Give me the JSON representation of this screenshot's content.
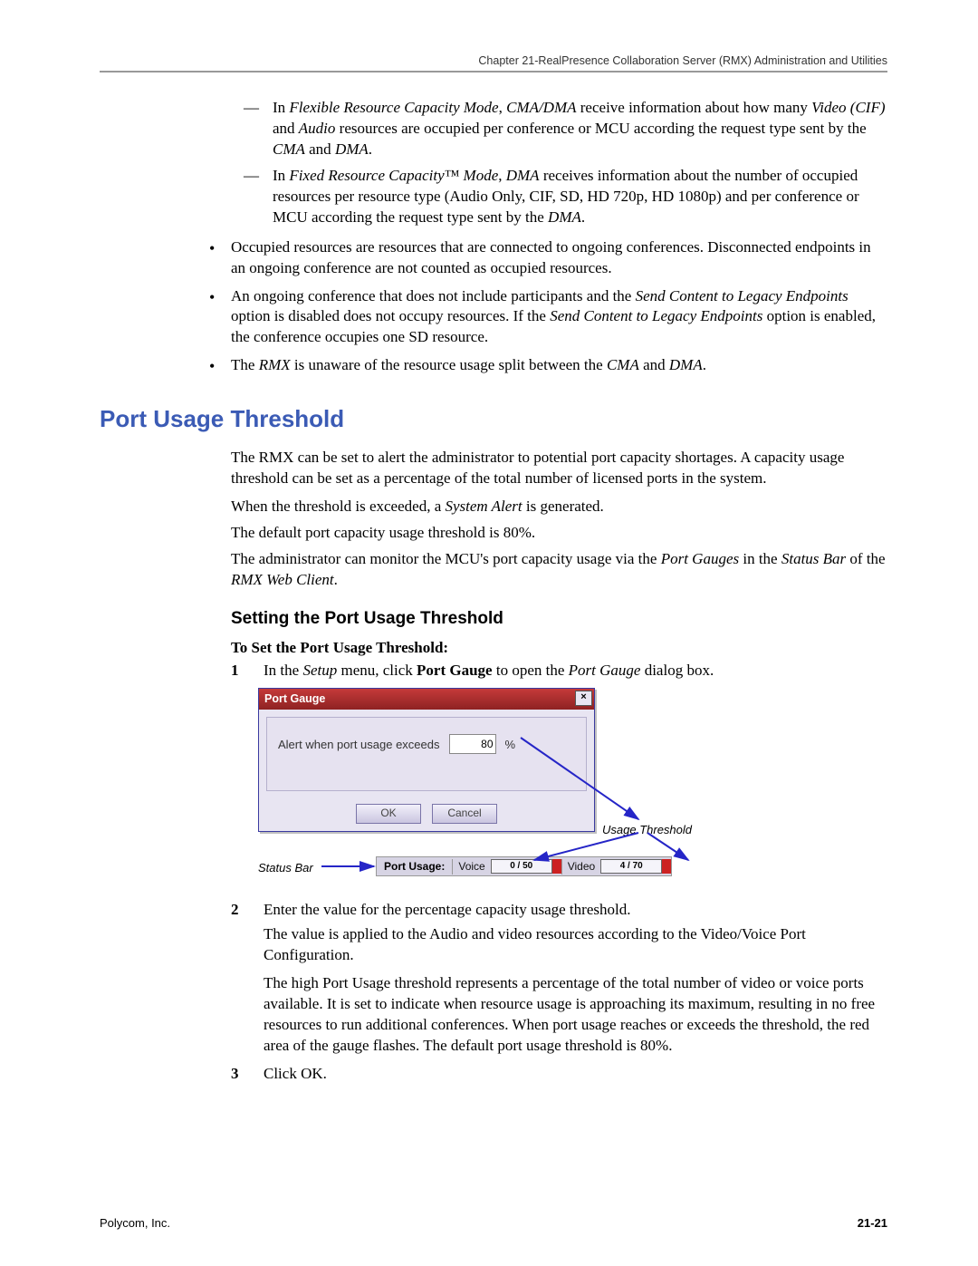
{
  "header": {
    "chapter": "Chapter 21-RealPresence Collaboration Server (RMX) Administration and Utilities"
  },
  "dash_items": [
    {
      "intro": "In ",
      "ital1": "Flexible Resource Capacity Mode",
      "mid1": ", ",
      "ital2": "CMA/DMA",
      "mid2": " receive information about how many ",
      "ital3": "Video (CIF)",
      "mid3": " and ",
      "ital4": "Audio",
      "tail": " resources are occupied per conference or MCU according the request type sent by the ",
      "ital5": "CMA",
      "mid5": " and ",
      "ital6": "DMA",
      "end": "."
    },
    {
      "intro2": " In ",
      "ital1b": "Fixed Resource Capacity™ Mode",
      "mid1b": ", ",
      "ital2b": "DMA",
      "tailb": " receives information about the number of occupied resources per resource type (Audio Only, CIF, SD, HD 720p, HD 1080p) and per conference or MCU according the request type sent by the ",
      "ital3b": "DMA",
      "endb": "."
    }
  ],
  "dot_items": [
    "Occupied resources are resources that are connected to ongoing conferences. Disconnected endpoints in an ongoing conference are not counted as occupied resources.",
    {
      "p1": "An ongoing conference that does not include participants and the ",
      "i1": "Send Content to Legacy Endpoints",
      "p2": " option is disabled does not occupy resources. If the ",
      "i2": "Send Content to Legacy Endpoints",
      "p3": " option is enabled, the conference occupies one SD resource."
    },
    {
      "p1": "The ",
      "i1": "RMX",
      "p2": " is unaware of the resource usage split between the ",
      "i2": "CMA",
      "p3": " and ",
      "i3": "DMA",
      "p4": "."
    }
  ],
  "section_title": "Port Usage Threshold",
  "para1": "The RMX can be set to alert the administrator to potential port capacity shortages. A capacity usage threshold can be set as a percentage of the total number of licensed ports in the system.",
  "para2_a": "When the threshold is exceeded, a ",
  "para2_i": "System Alert",
  "para2_b": " is generated.",
  "para3": "The default port capacity usage threshold is 80%.",
  "para4_a": "The administrator can monitor the MCU's port capacity usage via the ",
  "para4_i1": "Port Gauges",
  "para4_b": " in the ",
  "para4_i2": "Status Bar",
  "para4_c": " of the ",
  "para4_i3": "RMX Web Client",
  "para4_d": ".",
  "subsection_title": "Setting the Port Usage Threshold",
  "proc_title": "To Set the Port Usage Threshold:",
  "step1_a": "In the ",
  "step1_i1": "Setup",
  "step1_b": " menu, click ",
  "step1_bold": "Port Gauge",
  "step1_c": " to open the ",
  "step1_i2": "Port Gauge",
  "step1_d": " dialog box.",
  "dialog": {
    "title": "Port Gauge",
    "label": "Alert when port usage exceeds",
    "value": "80",
    "pct": "%",
    "ok": "OK",
    "cancel": "Cancel"
  },
  "callouts": {
    "usage_threshold": "Usage Threshold",
    "status_bar": "Status Bar"
  },
  "statusbar": {
    "label": "Port Usage:",
    "voice": "Voice",
    "voice_val": "0 / 50",
    "video": "Video",
    "video_val": "4 / 70"
  },
  "step2_a": "Enter the value for the percentage capacity usage threshold.",
  "step2_b": "The value is applied to the Audio and video resources according to the Video/Voice Port Configuration.",
  "step2_c": "The high Port Usage threshold represents a percentage of the total number of video or voice ports available. It is set to indicate when resource usage is approaching its maximum, resulting in no free resources to run additional conferences. When port usage reaches or exceeds the threshold, the red area of the gauge flashes. The default port usage threshold is 80%.",
  "step3_a": "Click ",
  "step3_b": "OK",
  "step3_c": ".",
  "footer": {
    "left": "Polycom, Inc.",
    "right": "21-21"
  }
}
